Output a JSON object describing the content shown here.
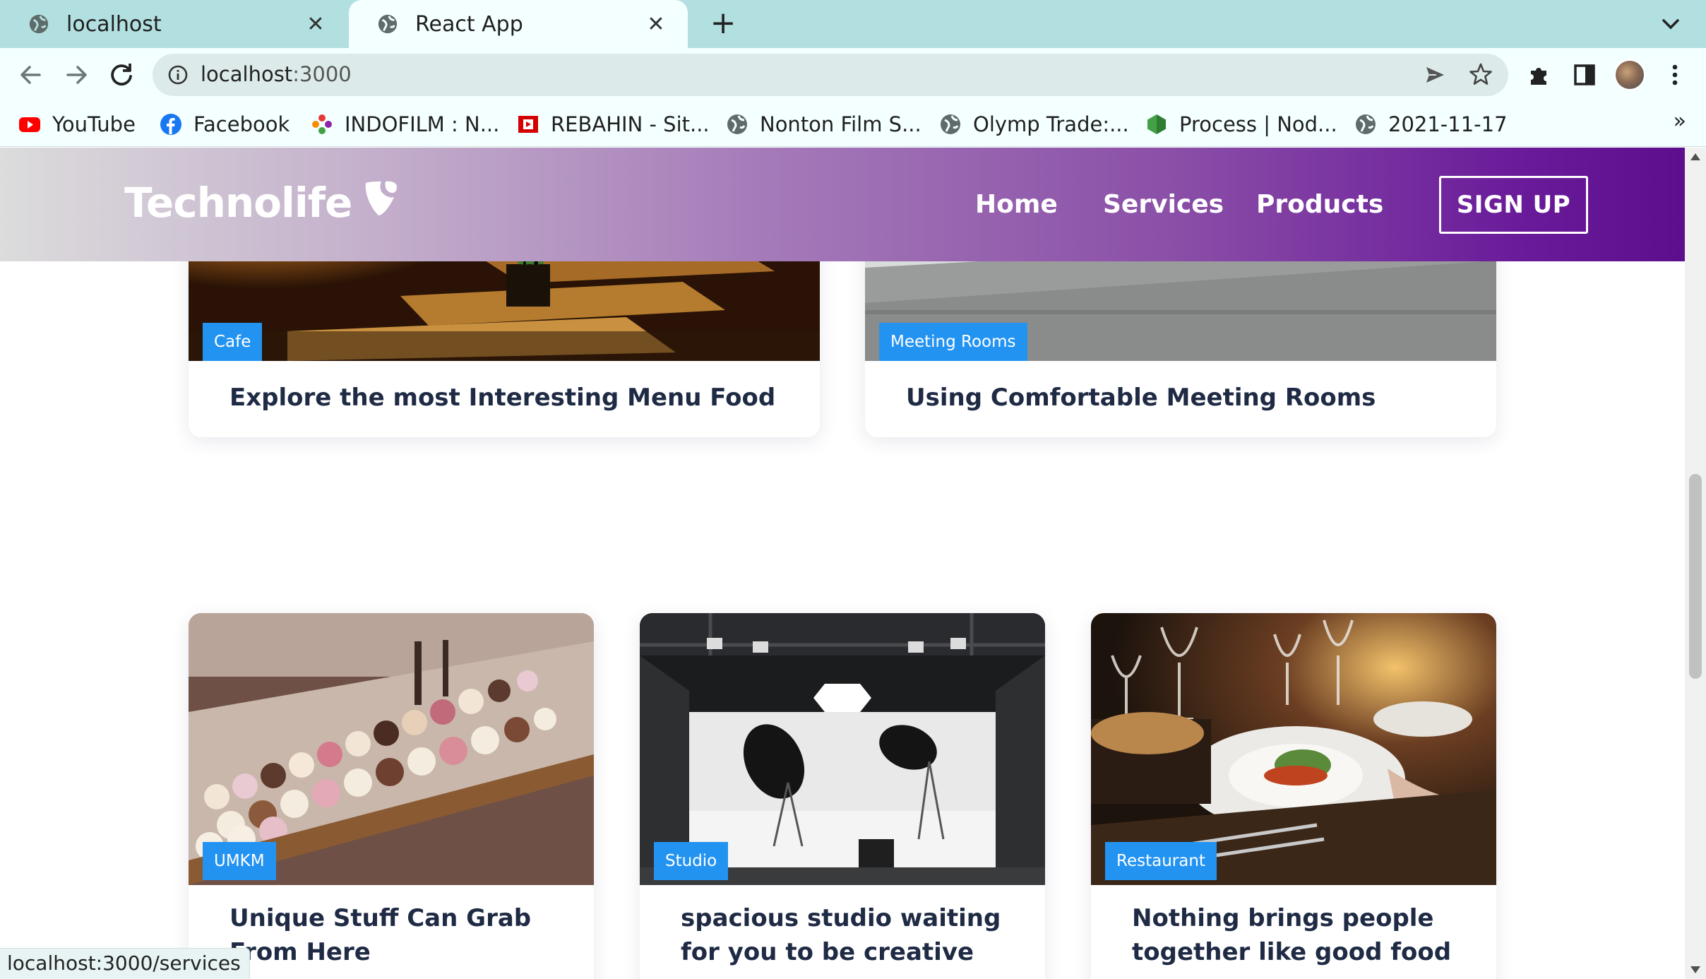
{
  "browser": {
    "tabs": [
      {
        "title": "localhost",
        "active": false
      },
      {
        "title": "React App",
        "active": true
      }
    ],
    "url_host": "localhost",
    "url_port": ":3000",
    "bookmarks": [
      {
        "label": "YouTube",
        "icon": "youtube-icon"
      },
      {
        "label": "Facebook",
        "icon": "facebook-icon"
      },
      {
        "label": "INDOFILM : N...",
        "icon": "indofilm-icon"
      },
      {
        "label": "REBAHIN - Sit...",
        "icon": "rebahin-icon"
      },
      {
        "label": "Nonton Film S...",
        "icon": "globe-icon"
      },
      {
        "label": "Olymp Trade:...",
        "icon": "globe-icon"
      },
      {
        "label": "Process | Nod...",
        "icon": "nodejs-icon"
      },
      {
        "label": "2021-11-17",
        "icon": "globe-icon"
      }
    ],
    "more_bookmarks": "»",
    "status_url": "localhost:3000/services"
  },
  "site": {
    "brand": "Technolife",
    "nav": [
      "Home",
      "Services",
      "Products"
    ],
    "signup": "SIGN UP",
    "colors": {
      "header_start": "#dcdcdc",
      "header_end": "#5c0e8c",
      "badge": "#2393f2",
      "title_text": "#1f2a44"
    }
  },
  "cards": [
    {
      "category": "Cafe",
      "title": "Explore the most Interesting Menu Food"
    },
    {
      "category": "Meeting Rooms",
      "title": "Using Comfortable Meeting Rooms"
    },
    {
      "category": "UMKM",
      "title": "Unique Stuff Can Grab From Here"
    },
    {
      "category": "Studio",
      "title": "spacious studio waiting for you to be creative"
    },
    {
      "category": "Restaurant",
      "title": "Nothing brings people together like good food"
    }
  ]
}
